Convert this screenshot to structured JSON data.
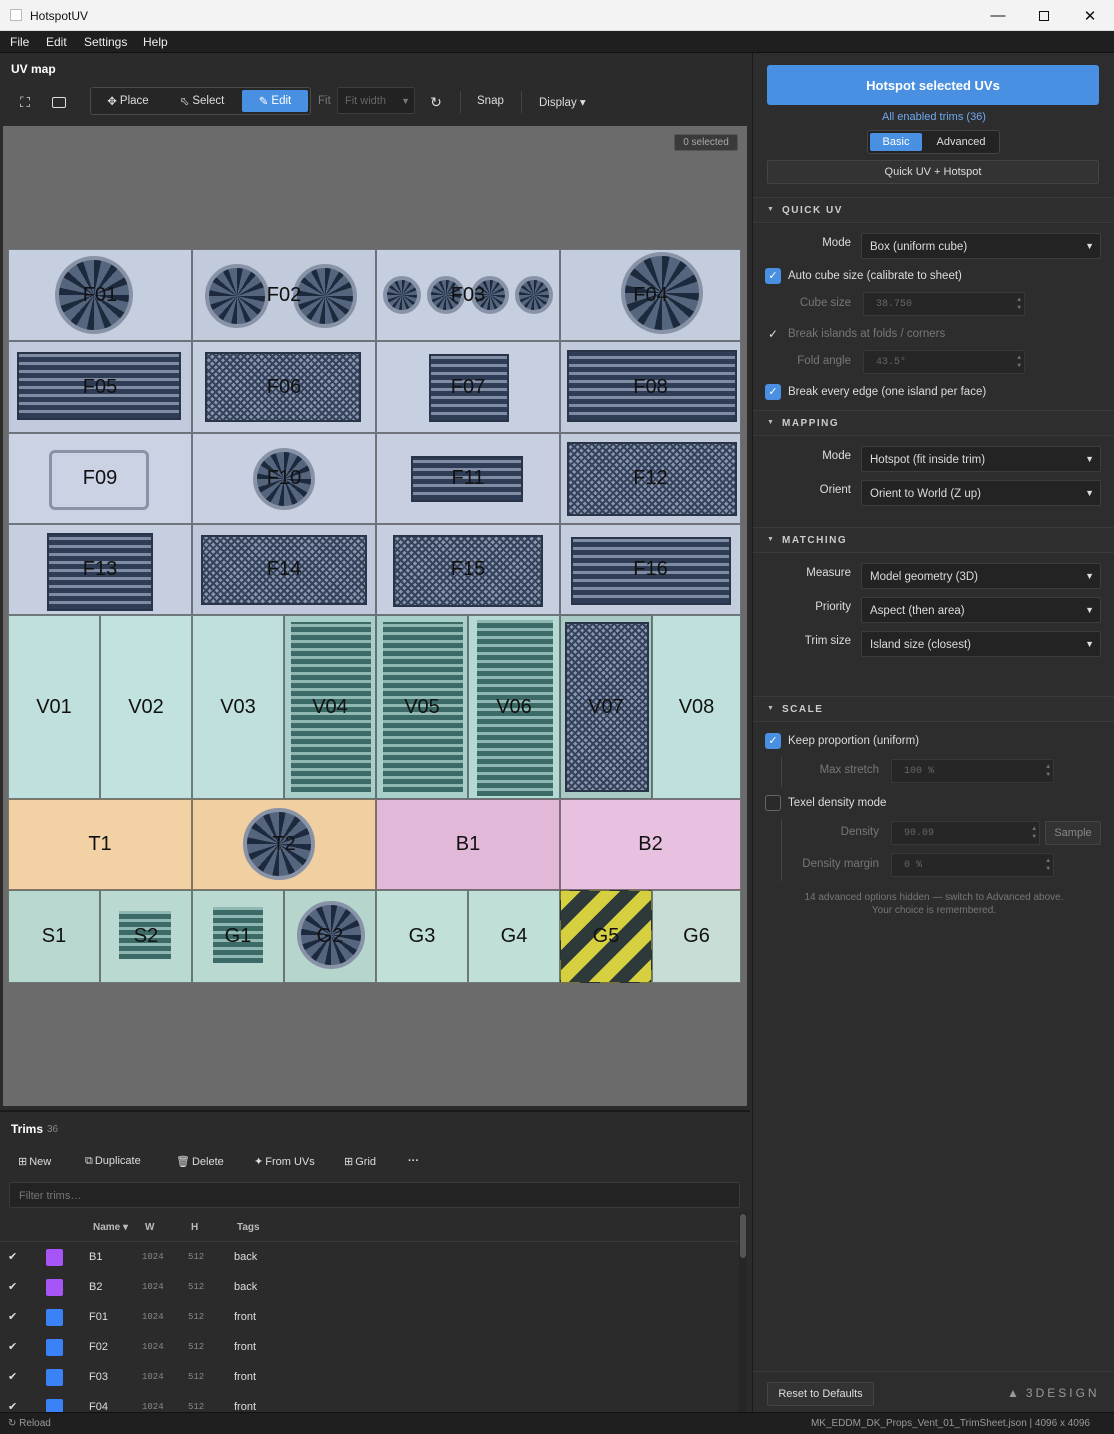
{
  "window": {
    "title": "HotspotUV"
  },
  "menu": [
    "File",
    "Edit",
    "Settings",
    "Help"
  ],
  "uvmap": {
    "title": "UV map",
    "tools": {
      "place": "Place",
      "select": "Select",
      "edit": "Edit",
      "active": "Edit"
    },
    "fit_label": "Fit",
    "fit_value": "Fit width",
    "snap": "Snap",
    "display": "Display ▾",
    "selected_badge": "0 selected"
  },
  "trims_sheet": [
    {
      "label": "F01",
      "color": "#c6cfe0"
    },
    {
      "label": "F02",
      "color": "#c2cbdc"
    },
    {
      "label": "F03",
      "color": "#c6cfe0"
    },
    {
      "label": "F04",
      "color": "#c4cdde"
    },
    {
      "label": "F05",
      "color": "#c2cbdd"
    },
    {
      "label": "F06",
      "color": "#c6cfe0"
    },
    {
      "label": "F07",
      "color": "#c7d0e1"
    },
    {
      "label": "F08",
      "color": "#c2cbdc"
    },
    {
      "label": "F09",
      "color": "#cad2e3"
    },
    {
      "label": "F10",
      "color": "#c8d0e1"
    },
    {
      "label": "F11",
      "color": "#c7cfe0"
    },
    {
      "label": "F12",
      "color": "#c2cbdc"
    },
    {
      "label": "F13",
      "color": "#c6cfe0"
    },
    {
      "label": "F14",
      "color": "#c0c9db"
    },
    {
      "label": "F15",
      "color": "#c6cfe0"
    },
    {
      "label": "F16",
      "color": "#c4cdde"
    },
    {
      "label": "V01",
      "color": "#bfe0dc"
    },
    {
      "label": "V02",
      "color": "#c1e2de"
    },
    {
      "label": "V03",
      "color": "#bfe0dc"
    },
    {
      "label": "V04",
      "color": "#a9cfca"
    },
    {
      "label": "V05",
      "color": "#a9cfca"
    },
    {
      "label": "V06",
      "color": "#b5d9d4"
    },
    {
      "label": "V07",
      "color": "#a8c9c4"
    },
    {
      "label": "V08",
      "color": "#bfe0dc"
    },
    {
      "label": "T1",
      "color": "#f2d2a4"
    },
    {
      "label": "T2",
      "color": "#f0d0a0"
    },
    {
      "label": "B1",
      "color": "#e2b8d9"
    },
    {
      "label": "B2",
      "color": "#e8c0e0"
    },
    {
      "label": "S1",
      "color": "#b7d7cf"
    },
    {
      "label": "S2",
      "color": "#b9d9d1"
    },
    {
      "label": "G1",
      "color": "#b9d9d1"
    },
    {
      "label": "G2",
      "color": "#b5d5cd"
    },
    {
      "label": "G3",
      "color": "#c1e0d9"
    },
    {
      "label": "G4",
      "color": "#bfdfd8"
    },
    {
      "label": "G5",
      "color": "#c9c24a"
    },
    {
      "label": "G6",
      "color": "#c8ddd5"
    }
  ],
  "trims_panel": {
    "title": "Trims",
    "count": "36",
    "buttons": {
      "new": "New",
      "duplicate": "Duplicate",
      "delete": "Delete",
      "from_uvs": "From UVs",
      "grid": "Grid",
      "more": "···"
    },
    "filter_placeholder": "Filter trims…",
    "columns": {
      "name": "Name ▾",
      "w": "W",
      "h": "H",
      "tags": "Tags"
    },
    "rows": [
      {
        "checked": "✔",
        "color": "#a855f7",
        "name": "B1",
        "w": "1024",
        "h": "512",
        "tags": "back"
      },
      {
        "checked": "✔",
        "color": "#a855f7",
        "name": "B2",
        "w": "1024",
        "h": "512",
        "tags": "back"
      },
      {
        "checked": "✔",
        "color": "#3b82f6",
        "name": "F01",
        "w": "1024",
        "h": "512",
        "tags": "front"
      },
      {
        "checked": "✔",
        "color": "#3b82f6",
        "name": "F02",
        "w": "1024",
        "h": "512",
        "tags": "front"
      },
      {
        "checked": "✔",
        "color": "#3b82f6",
        "name": "F03",
        "w": "1024",
        "h": "512",
        "tags": "front"
      },
      {
        "checked": "✔",
        "color": "#3b82f6",
        "name": "F04",
        "w": "1024",
        "h": "512",
        "tags": "front"
      }
    ]
  },
  "status": {
    "reload": "Reload",
    "file": "MK_EDDM_DK_Props_Vent_01_TrimSheet.json | 4096 x 4096"
  },
  "right": {
    "hotspot_button": "Hotspot selected UVs",
    "all_trims": "All enabled trims (36)",
    "tabs": {
      "basic": "Basic",
      "advanced": "Advanced",
      "active": "Basic"
    },
    "quick_button": "Quick UV + Hotspot",
    "quick_uv": {
      "section": "QUICK UV",
      "mode_label": "Mode",
      "mode_value": "Box (uniform cube)",
      "auto_cube": "Auto cube size (calibrate to sheet)",
      "cube_size_label": "Cube size",
      "cube_size_value": "38.750",
      "break_folds": "Break islands at folds / corners",
      "fold_angle_label": "Fold angle",
      "fold_angle_value": "43.5°",
      "break_every": "Break every edge (one island per face)"
    },
    "mapping": {
      "section": "MAPPING",
      "mode_label": "Mode",
      "mode_value": "Hotspot (fit inside trim)",
      "orient_label": "Orient",
      "orient_value": "Orient to World (Z up)"
    },
    "matching": {
      "section": "MATCHING",
      "measure_label": "Measure",
      "measure_value": "Model geometry (3D)",
      "priority_label": "Priority",
      "priority_value": "Aspect (then area)",
      "trim_size_label": "Trim size",
      "trim_size_value": "Island size (closest)"
    },
    "scale": {
      "section": "SCALE",
      "keep_prop": "Keep proportion (uniform)",
      "max_stretch_label": "Max stretch",
      "max_stretch_value": "100 %",
      "texel_mode": "Texel density mode",
      "density_label": "Density",
      "density_value": "90.09",
      "sample": "Sample",
      "margin_label": "Density margin",
      "margin_value": "0 %"
    },
    "hidden_note_1": "14 advanced options hidden — switch to Advanced above.",
    "hidden_note_2": "Your choice is remembered.",
    "reset": "Reset to Defaults",
    "brand": "3DESIGN"
  }
}
